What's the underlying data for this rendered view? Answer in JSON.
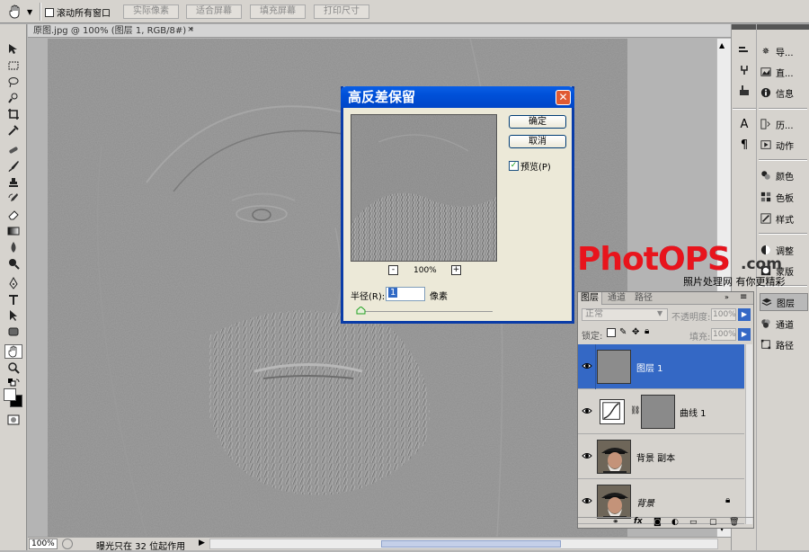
{
  "options_bar": {
    "scroll_all_windows_label": "滚动所有窗口",
    "buttons": [
      "实际像素",
      "适合屏幕",
      "填充屏幕",
      "打印尺寸"
    ]
  },
  "document": {
    "tab_title": "原图.jpg @ 100% (图层 1, RGB/8#) *",
    "close_glyph": "×",
    "zoom": "100%",
    "status_text": "曝光只在 32 位起作用"
  },
  "dialog": {
    "title": "高反差保留",
    "close_glyph": "✕",
    "ok_label": "确定",
    "cancel_label": "取消",
    "preview_label": "预览(P)",
    "preview_checked": true,
    "zoom_out": "-",
    "zoom_level": "100%",
    "zoom_in": "+",
    "radius_label": "半径(R):",
    "radius_value": "1",
    "radius_unit": "像素"
  },
  "watermark": {
    "logo_text": "PhotOPS",
    "logo_suffix": ".com",
    "tagline": "照片处理网 有你更精彩",
    "colors": {
      "primary": "#e8141c",
      "accent": "#1d4fa8"
    }
  },
  "dock": {
    "items": [
      {
        "label": "导...",
        "icon": "navigator-icon"
      },
      {
        "label": "直...",
        "icon": "histogram-icon"
      },
      {
        "label": "信息",
        "icon": "info-icon"
      },
      {
        "label": "历...",
        "icon": "history-icon"
      },
      {
        "label": "动作",
        "icon": "actions-icon"
      },
      {
        "label": "颜色",
        "icon": "color-icon"
      },
      {
        "label": "色板",
        "icon": "swatches-icon"
      },
      {
        "label": "样式",
        "icon": "styles-icon"
      },
      {
        "label": "调整",
        "icon": "adjustments-icon"
      },
      {
        "label": "蒙版",
        "icon": "masks-icon"
      },
      {
        "label": "图层",
        "icon": "layers-icon"
      },
      {
        "label": "通道",
        "icon": "channels-icon"
      },
      {
        "label": "路径",
        "icon": "paths-icon"
      }
    ]
  },
  "layers_panel": {
    "tabs": [
      "图层",
      "通道",
      "路径"
    ],
    "blend_mode": "正常",
    "opacity_label": "不透明度:",
    "opacity_value": "100%",
    "lock_label": "锁定:",
    "fill_label": "填充:",
    "fill_value": "100%",
    "layers": [
      {
        "name": "图层 1",
        "selected": true
      },
      {
        "name": "曲线 1",
        "selected": false
      },
      {
        "name": "背景 副本",
        "selected": false
      },
      {
        "name": "背景",
        "selected": false,
        "locked": true
      }
    ]
  }
}
